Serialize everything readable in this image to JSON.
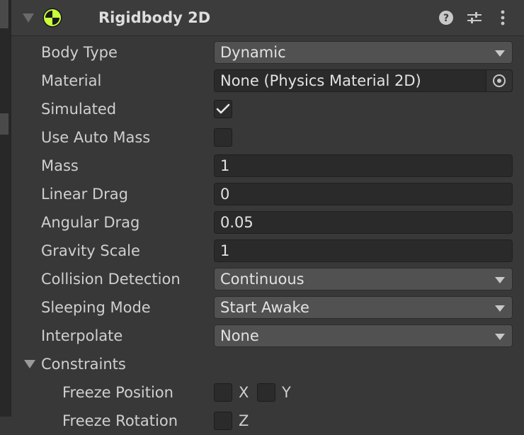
{
  "component": {
    "title": "Rigidbody 2D",
    "icons": [
      "rigidbody-icon",
      "help-icon",
      "presets-icon",
      "context-menu-icon"
    ]
  },
  "fields": {
    "body_type": {
      "label": "Body Type",
      "value": "Dynamic"
    },
    "material": {
      "label": "Material",
      "value": "None (Physics Material 2D)"
    },
    "simulated": {
      "label": "Simulated",
      "checked": true
    },
    "use_auto_mass": {
      "label": "Use Auto Mass",
      "checked": false
    },
    "mass": {
      "label": "Mass",
      "value": "1"
    },
    "linear_drag": {
      "label": "Linear Drag",
      "value": "0"
    },
    "angular_drag": {
      "label": "Angular Drag",
      "value": "0.05"
    },
    "gravity_scale": {
      "label": "Gravity Scale",
      "value": "1"
    },
    "collision_detection": {
      "label": "Collision Detection",
      "value": "Continuous"
    },
    "sleeping_mode": {
      "label": "Sleeping Mode",
      "value": "Start Awake"
    },
    "interpolate": {
      "label": "Interpolate",
      "value": "None"
    }
  },
  "constraints": {
    "label": "Constraints",
    "freeze_position": {
      "label": "Freeze Position",
      "x_label": "X",
      "y_label": "Y"
    },
    "freeze_rotation": {
      "label": "Freeze Rotation",
      "z_label": "Z"
    }
  },
  "colors": {
    "background": "#383838",
    "field_bg": "#2a2a2a",
    "dropdown_bg": "#515151",
    "icon_green": "#c8ff3c"
  }
}
